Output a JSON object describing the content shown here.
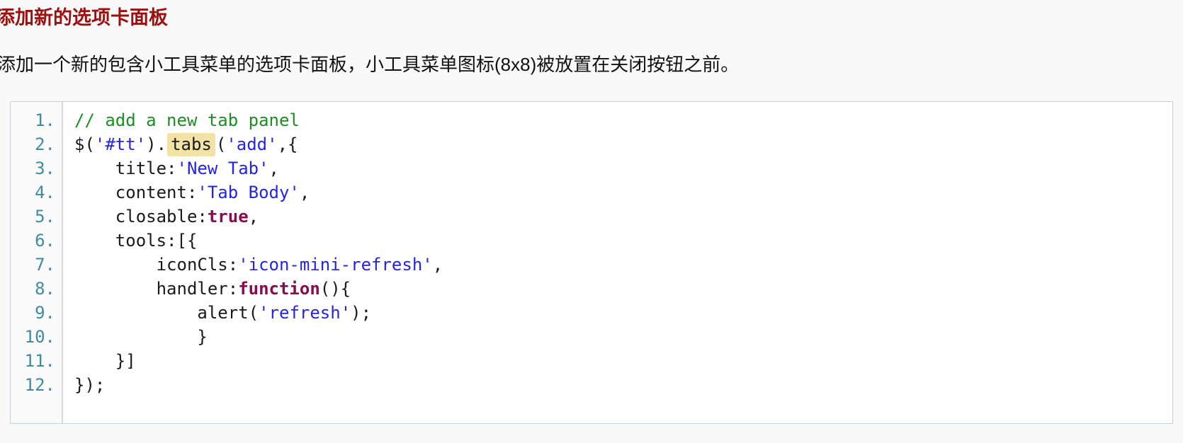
{
  "page": {
    "background_color": "#f9f9f9"
  },
  "heading": {
    "text": "添加新的选项卡面板",
    "color": "#9c1010"
  },
  "paragraph": {
    "text": "添加一个新的包含小工具菜单的选项卡面板，小工具菜单图标(8x8)被放置在关闭按钮之前。",
    "color": "#111111"
  },
  "code_block": {
    "language": "javascript",
    "border_color": "#c9ced6",
    "background_color": "#ffffff",
    "gutter_background_color": "#fafafa",
    "line_number_color": "#3d8ca3",
    "highlight_color": "#f3e2a6",
    "comment_color": "#1c8e24",
    "string_color": "#2424e8",
    "keyword_color": "#8a0b52",
    "line_numbers": [
      "1.",
      "2.",
      "3.",
      "4.",
      "5.",
      "6.",
      "7.",
      "8.",
      "9.",
      "10.",
      "11.",
      "12."
    ],
    "plain_text": "// add a new tab panel\n$('#tt').tabs('add',{\n    title:'New Tab',\n    content:'Tab Body',\n    closable:true,\n    tools:[{\n        iconCls:'icon-mini-refresh',\n        handler:function(){\n            alert('refresh');\n        }\n    }]\n});",
    "lines": [
      {
        "number": "1.",
        "tokens": [
          {
            "type": "comment",
            "text": "// add a new tab panel"
          }
        ]
      },
      {
        "number": "2.",
        "tokens": [
          {
            "type": "plain",
            "text": "$("
          },
          {
            "type": "string",
            "text": "'#tt'"
          },
          {
            "type": "plain",
            "text": ")."
          },
          {
            "type": "mark",
            "text": "tabs"
          },
          {
            "type": "plain",
            "text": "("
          },
          {
            "type": "string",
            "text": "'add'"
          },
          {
            "type": "plain",
            "text": ",{"
          }
        ]
      },
      {
        "number": "3.",
        "tokens": [
          {
            "type": "plain",
            "text": "    title:"
          },
          {
            "type": "string",
            "text": "'New Tab'"
          },
          {
            "type": "plain",
            "text": ","
          }
        ]
      },
      {
        "number": "4.",
        "tokens": [
          {
            "type": "plain",
            "text": "    content:"
          },
          {
            "type": "string",
            "text": "'Tab Body'"
          },
          {
            "type": "plain",
            "text": ","
          }
        ]
      },
      {
        "number": "5.",
        "tokens": [
          {
            "type": "plain",
            "text": "    closable:"
          },
          {
            "type": "keyword",
            "text": "true"
          },
          {
            "type": "plain",
            "text": ","
          }
        ]
      },
      {
        "number": "6.",
        "tokens": [
          {
            "type": "plain",
            "text": "    tools:[{"
          }
        ]
      },
      {
        "number": "7.",
        "tokens": [
          {
            "type": "plain",
            "text": "        iconCls:"
          },
          {
            "type": "string",
            "text": "'icon-mini-refresh'"
          },
          {
            "type": "plain",
            "text": ","
          }
        ]
      },
      {
        "number": "8.",
        "tokens": [
          {
            "type": "plain",
            "text": "        handler:"
          },
          {
            "type": "keyword",
            "text": "function"
          },
          {
            "type": "plain",
            "text": "(){"
          }
        ]
      },
      {
        "number": "9.",
        "tokens": [
          {
            "type": "plain",
            "text": "            alert("
          },
          {
            "type": "string",
            "text": "'refresh'"
          },
          {
            "type": "plain",
            "text": ");"
          }
        ]
      },
      {
        "number": "10.",
        "tokens": [
          {
            "type": "plain",
            "text": "            }"
          }
        ]
      },
      {
        "number": "11.",
        "tokens": [
          {
            "type": "plain",
            "text": "    }]"
          }
        ]
      },
      {
        "number": "12.",
        "tokens": [
          {
            "type": "plain",
            "text": "});"
          }
        ]
      }
    ]
  }
}
